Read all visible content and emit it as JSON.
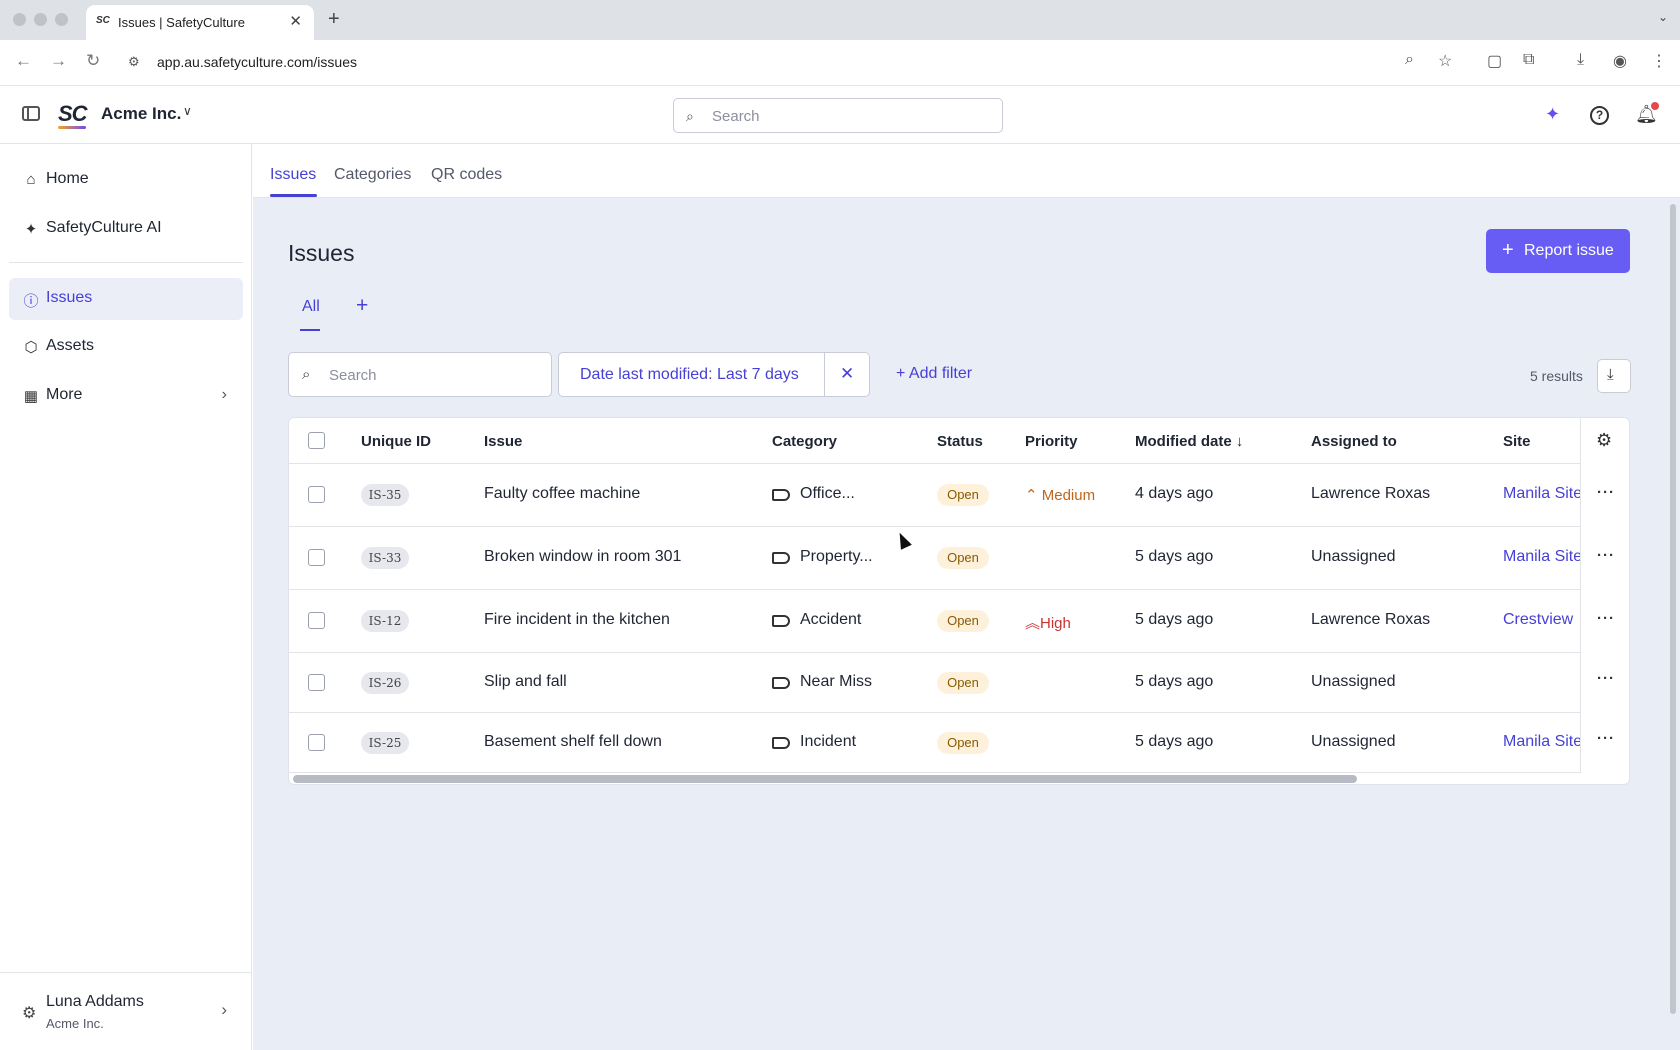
{
  "browser": {
    "tab_title": "Issues | SafetyCulture",
    "tab_favicon": "SC",
    "url": "app.au.safetyculture.com/issues",
    "icons": [
      "back-icon",
      "forward-icon",
      "reload-icon",
      "zoom-icon",
      "star-icon",
      "cast-icon",
      "extensions-icon",
      "download-icon",
      "profile-icon",
      "menu-icon"
    ]
  },
  "header": {
    "logo": "SC",
    "org_name": "Acme Inc.",
    "search_placeholder": "Search"
  },
  "sidebar": {
    "items": [
      {
        "label": "Home",
        "icon": "home-icon"
      },
      {
        "label": "SafetyCulture AI",
        "icon": "sparkle-icon"
      },
      {
        "label": "Issues",
        "icon": "alert-icon",
        "active": true
      },
      {
        "label": "Assets",
        "icon": "cube-icon"
      },
      {
        "label": "More",
        "icon": "grid-icon"
      }
    ],
    "user": {
      "name": "Luna Addams",
      "org": "Acme Inc."
    }
  },
  "subtabs": [
    "Issues",
    "Categories",
    "QR codes"
  ],
  "main": {
    "title": "Issues",
    "report_button": "Report issue",
    "view_tab": "All",
    "search_placeholder": "Search",
    "filter_chip": "Date last modified: Last 7 days",
    "add_filter": "Add filter",
    "results": "5 results"
  },
  "table": {
    "columns": [
      "Unique ID",
      "Issue",
      "Category",
      "Status",
      "Priority",
      "Modified date",
      "Assigned to",
      "Site"
    ],
    "rows": [
      {
        "id": "IS-35",
        "issue": "Faulty coffee machine",
        "category": "Office...",
        "status": "Open",
        "priority": "Medium",
        "modified": "4 days ago",
        "assigned": "Lawrence Roxas",
        "site": "Manila Site"
      },
      {
        "id": "IS-33",
        "issue": "Broken window in room 301",
        "category": "Property...",
        "status": "Open",
        "priority": "",
        "modified": "5 days ago",
        "assigned": "Unassigned",
        "site": "Manila Site"
      },
      {
        "id": "IS-12",
        "issue": "Fire incident in the kitchen",
        "category": "Accident",
        "status": "Open",
        "priority": "High",
        "modified": "5 days ago",
        "assigned": "Lawrence Roxas",
        "site": "Crestview"
      },
      {
        "id": "IS-26",
        "issue": "Slip and fall",
        "category": "Near Miss",
        "status": "Open",
        "priority": "",
        "modified": "5 days ago",
        "assigned": "Unassigned",
        "site": ""
      },
      {
        "id": "IS-25",
        "issue": "Basement shelf fell down",
        "category": "Incident",
        "status": "Open",
        "priority": "",
        "modified": "5 days ago",
        "assigned": "Unassigned",
        "site": "Manila Site"
      }
    ]
  },
  "colors": {
    "accent": "#675df4",
    "link": "#4740d4",
    "status_open_bg": "#fdf1dc",
    "priority_medium": "#c0651b",
    "priority_high": "#c7342f"
  }
}
